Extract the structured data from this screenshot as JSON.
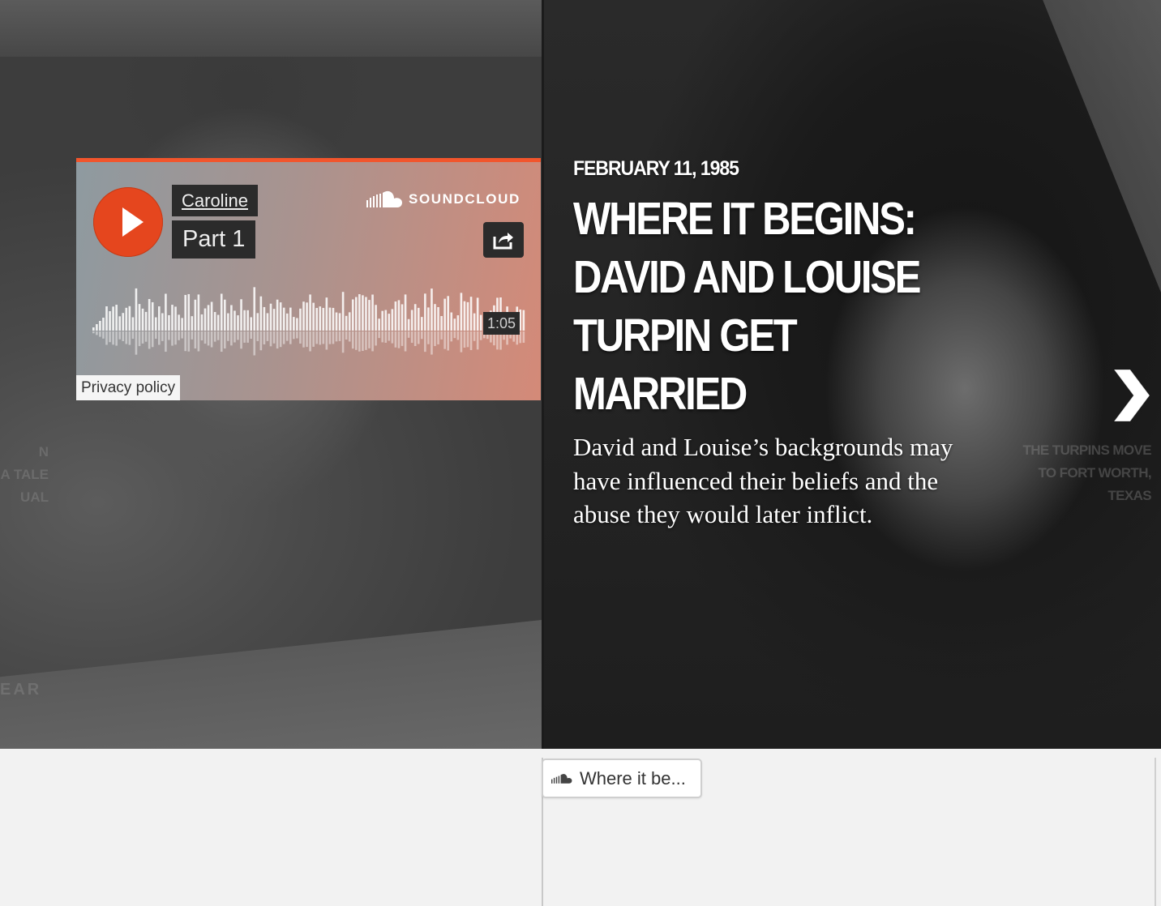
{
  "slide": {
    "date": "FEBRUARY 11, 1985",
    "title": "WHERE IT BEGINS: DAVID AND LOUISE TURPIN GET MARRIED",
    "dek": "David and Louise’s backgrounds may have influenced their beliefs and the abuse they would later inflict."
  },
  "prev_slide_ghost": {
    "lines": [
      "N",
      "A TALE",
      "UAL"
    ],
    "bottom": "EAR"
  },
  "next_slide_ghost": {
    "title": "THE TURPINS MOVE TO FORT WORTH, TEXAS"
  },
  "player": {
    "artist": "Caroline",
    "track": "Part 1",
    "brand": "SOUNDCLOUD",
    "duration": "1:05",
    "privacy": "Privacy policy",
    "accent_color": "#f2552c",
    "play_icon": "play-icon",
    "share_icon": "share-icon"
  },
  "mini_player": {
    "label": "Where it be...",
    "icon": "soundcloud-icon"
  },
  "navigation": {
    "next_icon": "chevron-right-icon"
  }
}
